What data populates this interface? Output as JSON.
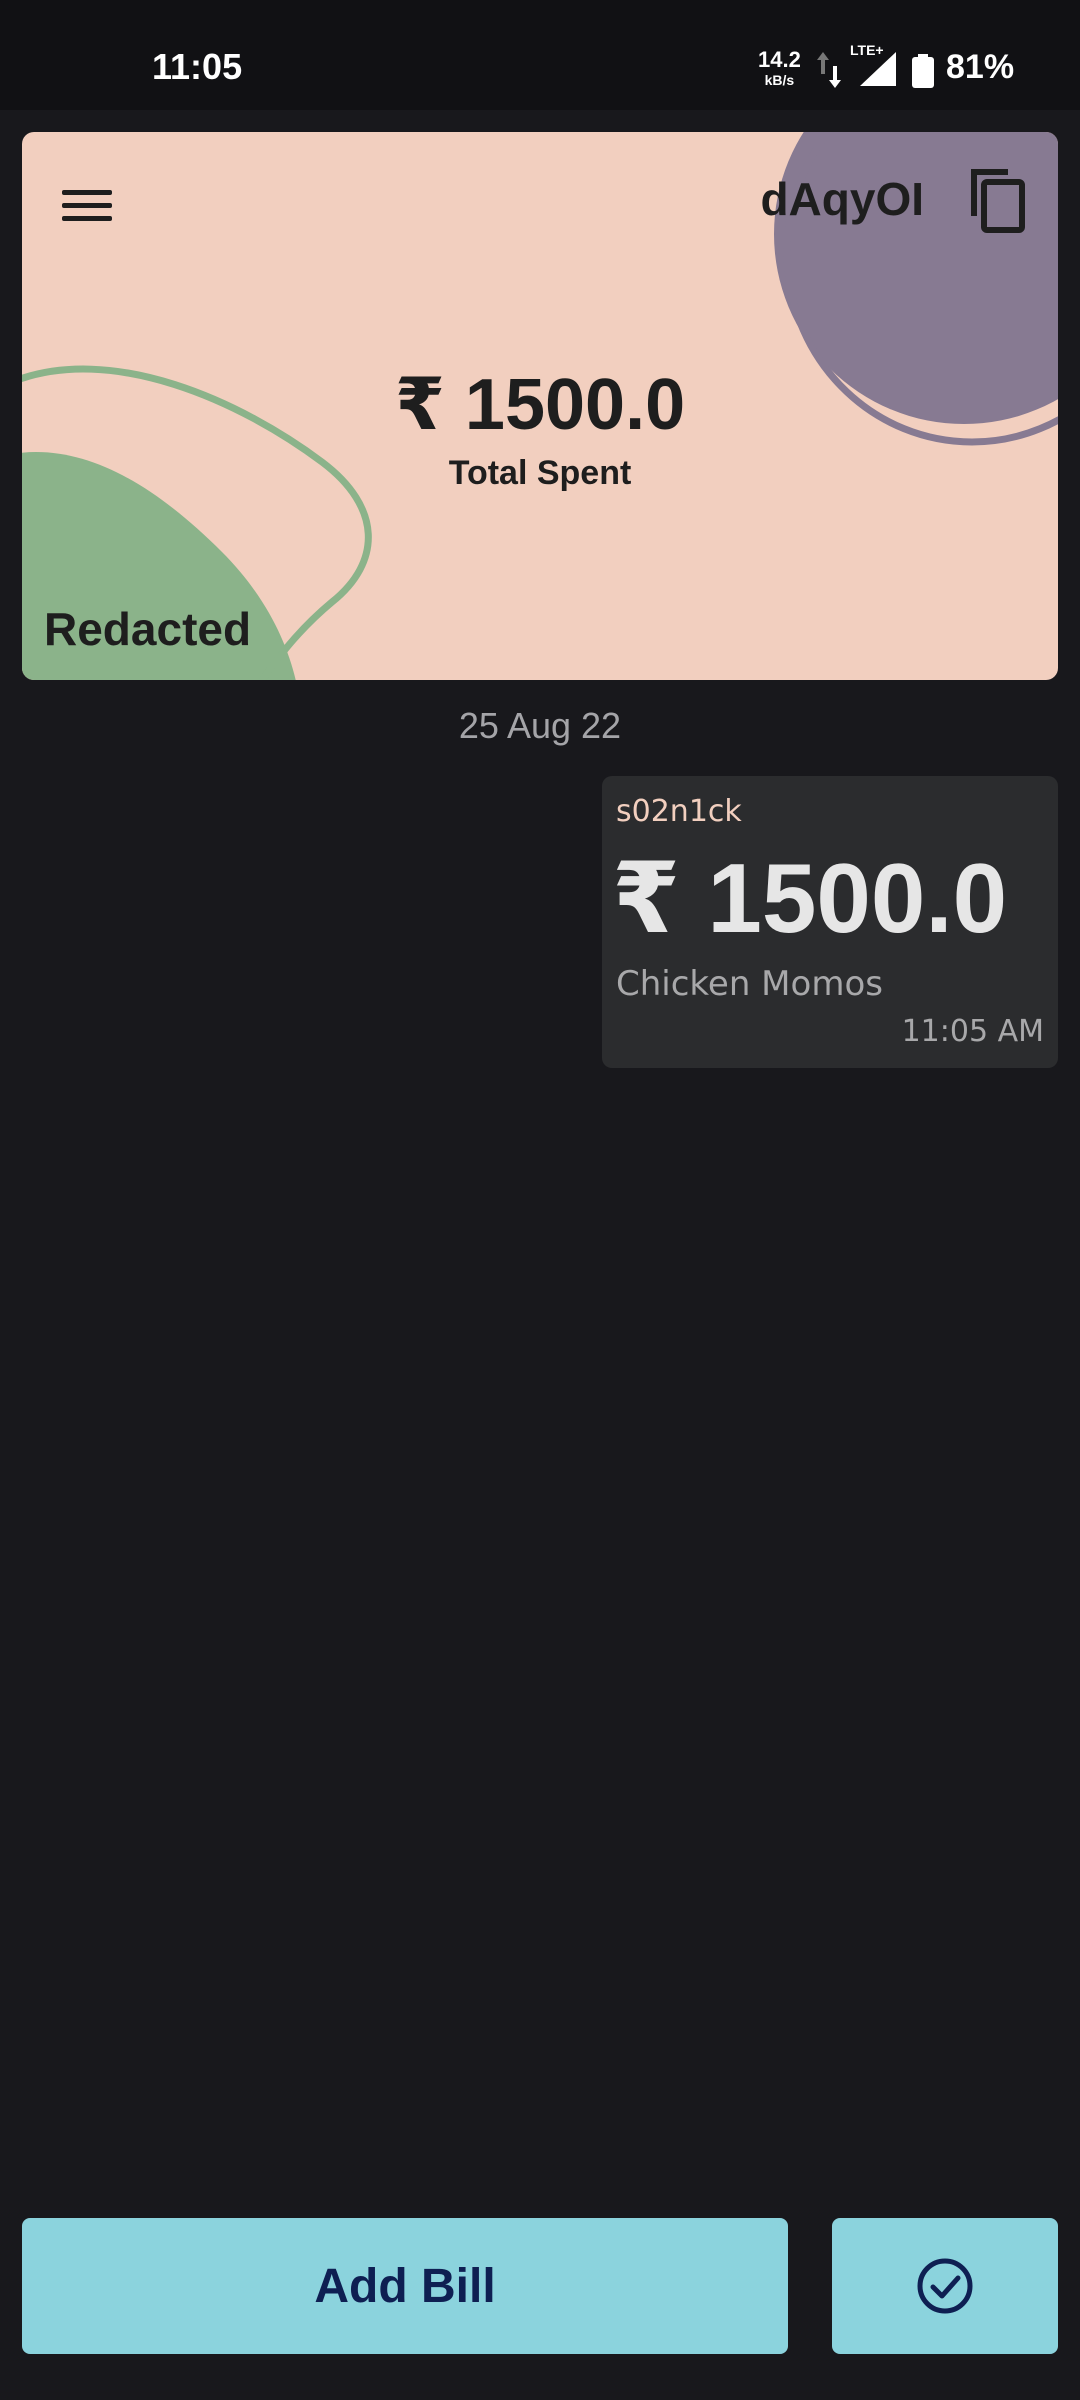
{
  "status_bar": {
    "time": "11:05",
    "net_speed": "14.2",
    "net_speed_unit": "kB/s",
    "network_type": "LTE+",
    "battery": "81%"
  },
  "header_card": {
    "room_code": "dAqyOI",
    "total_amount": "₹ 1500.0",
    "total_label": "Total Spent",
    "group_name": "Redacted",
    "colors": {
      "background": "#f2cfbf",
      "purple_blob": "#877a92",
      "green_blob": "#8bb38a"
    },
    "icons": {
      "menu": "hamburger-menu-icon",
      "copy": "copy-icon"
    }
  },
  "feed": {
    "date": "25 Aug 22",
    "bills": [
      {
        "user": "s02n1ck",
        "amount": "₹ 1500.0",
        "description": "Chicken Momos",
        "time": "11:05 AM"
      }
    ]
  },
  "actions": {
    "add_bill_label": "Add Bill",
    "settle_icon": "check-circle-icon",
    "button_color": "#8bd3dd",
    "text_color": "#0e1f52"
  }
}
